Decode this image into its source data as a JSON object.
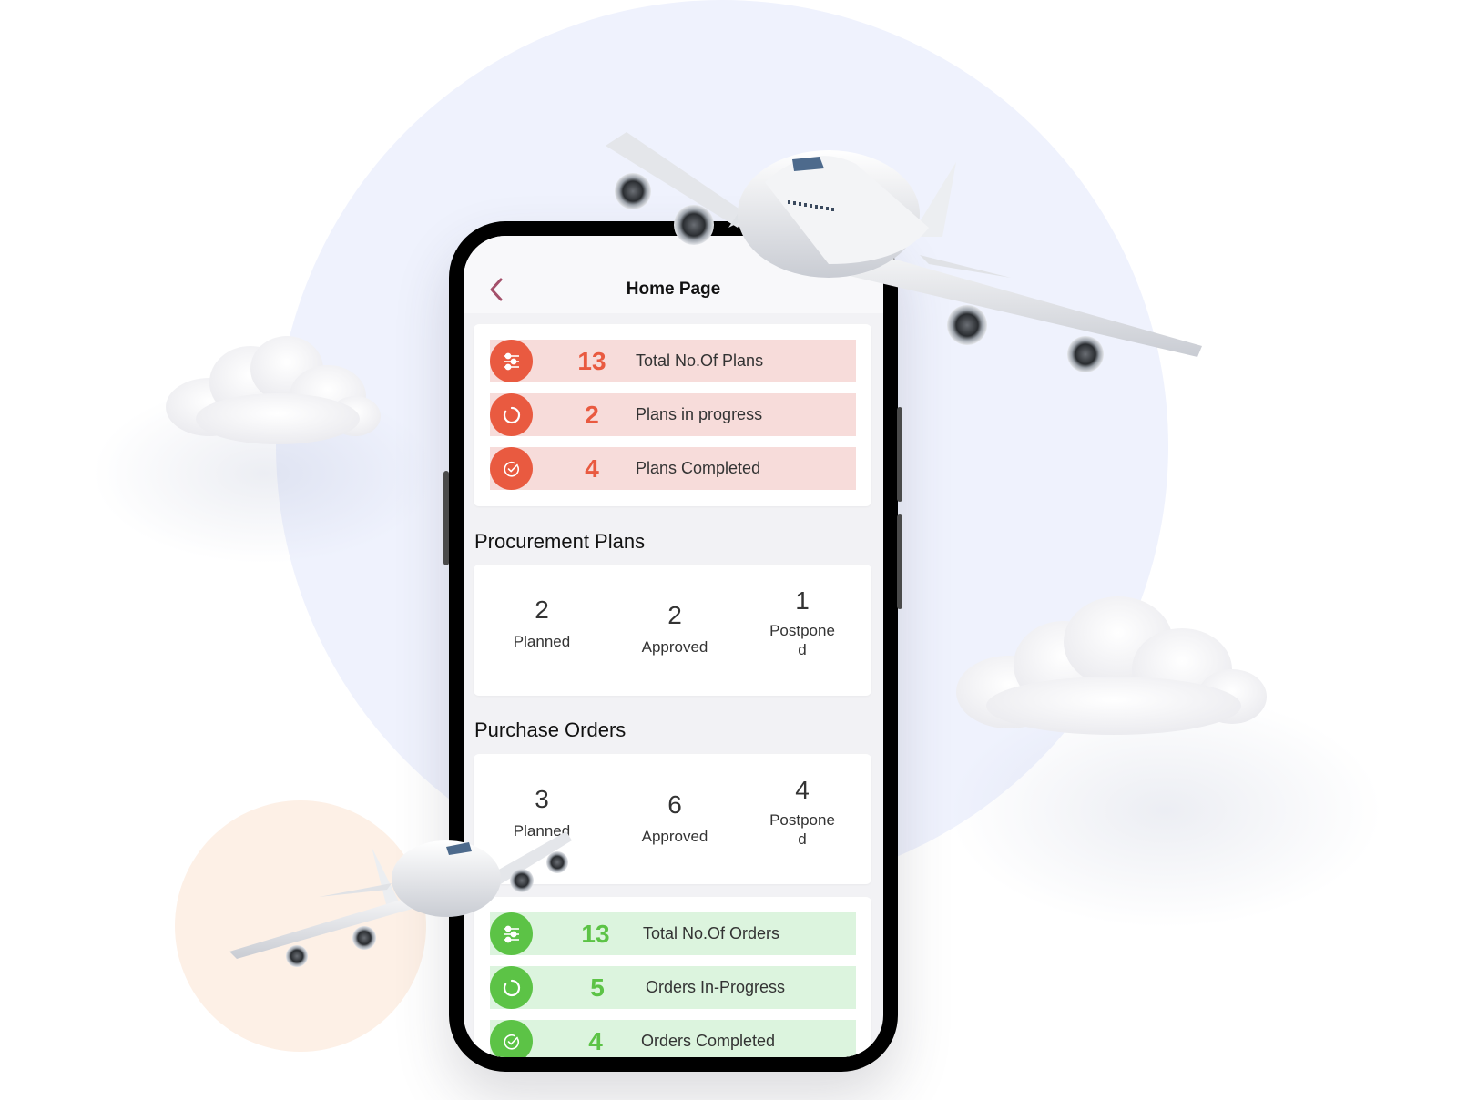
{
  "header": {
    "title": "Home Page",
    "back_icon": "chevron-left-icon"
  },
  "colors": {
    "plan_accent": "#e95a40",
    "plan_row_bg": "#f7dcda",
    "order_accent": "#5cc346",
    "order_row_bg": "#dcf4de",
    "back_icon": "#a4506a"
  },
  "plan_summary": [
    {
      "icon": "sliders-icon",
      "value": "13",
      "label": "Total No.Of Plans"
    },
    {
      "icon": "progress-circle-icon",
      "value": "2",
      "label": "Plans in progress"
    },
    {
      "icon": "check-circle-icon",
      "value": "4",
      "label": "Plans Completed"
    }
  ],
  "procurement_plans": {
    "title": "Procurement Plans",
    "stats": [
      {
        "value": "2",
        "label": "Planned"
      },
      {
        "value": "2",
        "label": "Approved"
      },
      {
        "value": "1",
        "label": "Postponed"
      }
    ]
  },
  "purchase_orders": {
    "title": "Purchase Orders",
    "stats": [
      {
        "value": "3",
        "label": "Planned"
      },
      {
        "value": "6",
        "label": "Approved"
      },
      {
        "value": "4",
        "label": "Postponed"
      }
    ]
  },
  "order_summary": [
    {
      "icon": "sliders-icon",
      "value": "13",
      "label": "Total No.Of Orders"
    },
    {
      "icon": "progress-circle-icon",
      "value": "5",
      "label": "Orders In-Progress"
    },
    {
      "icon": "check-circle-icon",
      "value": "4",
      "label": "Orders Completed"
    }
  ]
}
